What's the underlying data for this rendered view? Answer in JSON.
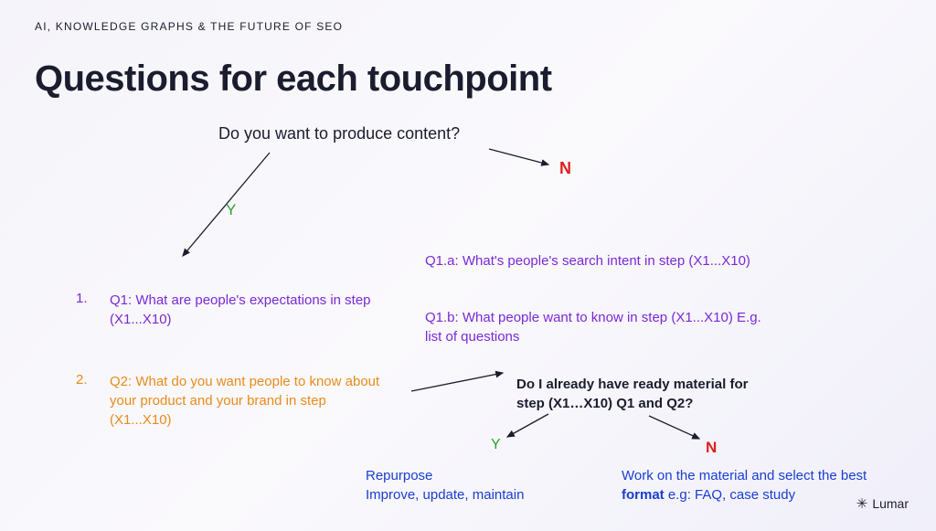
{
  "header": "AI, KNOWLEDGE GRAPHS & THE FUTURE OF SEO",
  "title": "Questions for each touchpoint",
  "question_main": "Do you want to produce content?",
  "n_label": "N",
  "y_label": "Y",
  "q1": {
    "num": "1.",
    "text": "Q1: What are people's expectations in step (X1...X10)"
  },
  "q1a": "Q1.a: What's people's search intent in step (X1...X10)",
  "q1b": "Q1.b: What people want to know in step (X1...X10) E.g. list of questions",
  "q2": {
    "num": "2.",
    "text": "Q2: What do you want people to know about your product and your brand in step (X1...X10)"
  },
  "question_sub": "Do I already have ready material for step (X1…X10) Q1 and Q2?",
  "repurpose": {
    "line1": "Repurpose",
    "line2": "Improve, update, maintain"
  },
  "work": {
    "pre": "Work on the material and select the best ",
    "fmt": "format",
    "post": " e.g: FAQ, case study"
  },
  "logo": "Lumar"
}
